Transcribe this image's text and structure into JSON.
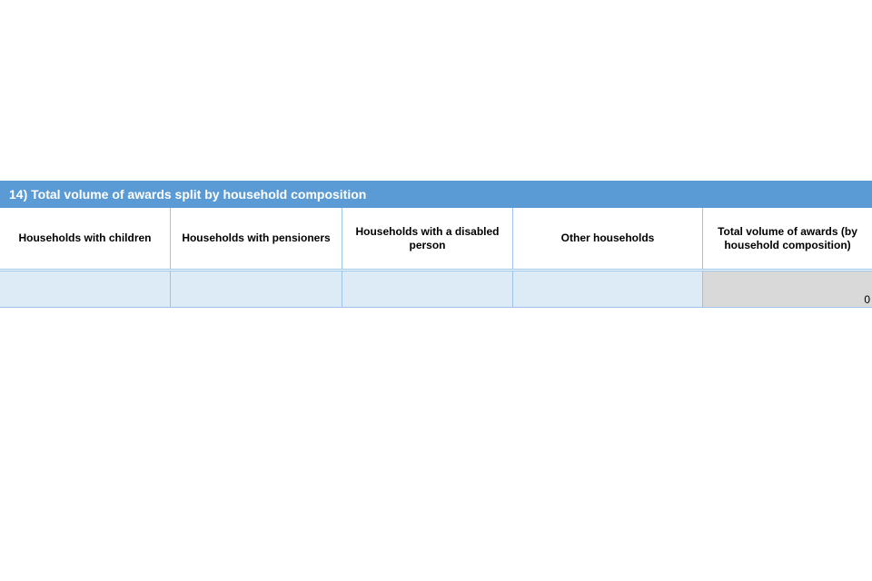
{
  "section": {
    "title": "14) Total volume of awards split by household composition"
  },
  "table": {
    "headers": [
      "Households with children",
      "Households with pensioners",
      "Households with a disabled person",
      "Other households",
      "Total volume of awards (by household composition)"
    ],
    "row": {
      "values": [
        "",
        "",
        "",
        ""
      ],
      "total": "0"
    }
  },
  "colors": {
    "header_band": "#5b9bd5",
    "input_cell": "#ddebf7",
    "total_cell": "#d9d9d9",
    "grid_line": "#9dc3e6"
  }
}
